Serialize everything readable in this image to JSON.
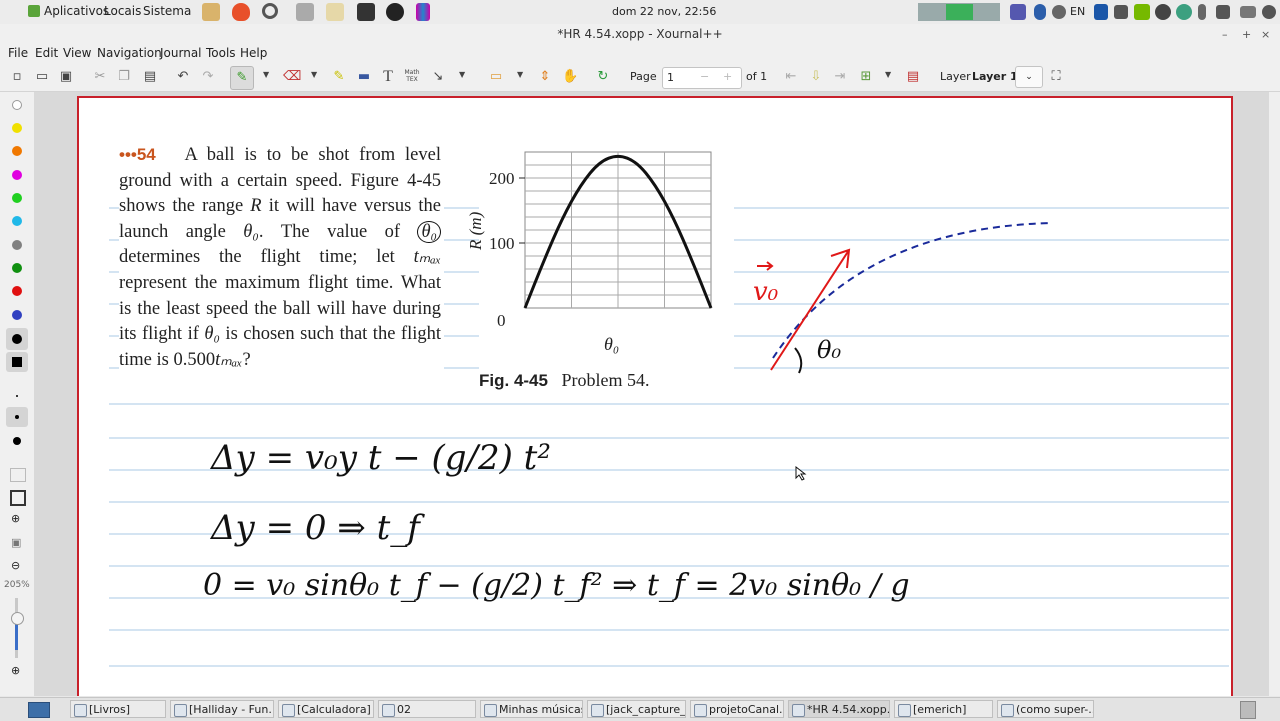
{
  "top_panel": {
    "menus": [
      "Aplicativos",
      "Locais",
      "Sistema"
    ],
    "clock": "dom 22 nov, 22:56",
    "keyboard_layout": "EN"
  },
  "window": {
    "title": "*HR 4.54.xopp - Xournal++",
    "min_glyph": "–",
    "max_glyph": "+",
    "close_glyph": "×"
  },
  "menubar": [
    "File",
    "Edit",
    "View",
    "Navigation",
    "Journal",
    "Tools",
    "Help"
  ],
  "toolbar": {
    "page_label": "Page",
    "page_value": "1",
    "of_label": "of 1",
    "layer_label": "Layer",
    "layer_value": "Layer 1",
    "math_tex_line1": "Math",
    "math_tex_line2": "TEX"
  },
  "palette": {
    "colors": [
      "#ffffff",
      "#f0e000",
      "#f07800",
      "#e000e0",
      "#20d020",
      "#20b8e8",
      "#808080",
      "#109010",
      "#e01010",
      "#3040c0",
      "#000000"
    ],
    "zoom_label": "205%"
  },
  "problem": {
    "number": "•••54",
    "text_1": "A ball is to be shot from level ground with a certain speed. Figure 4-45 shows the range ",
    "R": "R",
    "text_2": " it will have versus the launch angle ",
    "theta0": "θ₀",
    "text_3": ". The value of ",
    "text_4": " determines the flight time; let ",
    "tmax": "tₘₐₓ",
    "text_5": " represent the maximum flight time. What is the least speed the ball will have during its flight if ",
    "text_6": " is chosen such that the flight time is 0.500",
    "text_7": "?"
  },
  "figure": {
    "caption_label": "Fig. 4-45",
    "caption_text": "Problem 54.",
    "xlabel": "θ₀",
    "ylabel": "R (m)"
  },
  "chart_data": {
    "type": "line",
    "title": "",
    "xlabel": "θ₀",
    "ylabel": "R (m)",
    "yticks": [
      0,
      100,
      200
    ],
    "ylim": [
      0,
      240
    ],
    "series": [
      {
        "x": [
          0,
          0.1,
          0.2,
          0.3,
          0.4,
          0.5,
          0.6,
          0.7,
          0.8,
          0.9,
          1.0
        ],
        "values": [
          0,
          72,
          138,
          190,
          225,
          236,
          225,
          190,
          138,
          72,
          0
        ]
      }
    ],
    "grid": true
  },
  "handwriting": {
    "sketch_v0": "v₀",
    "sketch_theta": "θ₀",
    "line1": "Δy = v₀y t − (g/2) t²",
    "line2": "Δy = 0  ⇒  t_f",
    "line3": "0 = v₀ sinθ₀ t_f − (g/2) t_f²  ⇒  t_f = 2v₀ sinθ₀ / g"
  },
  "taskbar": [
    {
      "label": "[Livros]",
      "active": false
    },
    {
      "label": "[Halliday - Fun...",
      "active": false
    },
    {
      "label": "[Calculadora]",
      "active": false
    },
    {
      "label": "02",
      "active": false
    },
    {
      "label": "Minhas músicas",
      "active": false
    },
    {
      "label": "[jack_capture_...",
      "active": false
    },
    {
      "label": "projetoCanal.k...",
      "active": false
    },
    {
      "label": "*HR 4.54.xopp...",
      "active": true
    },
    {
      "label": "[emerich]",
      "active": false
    },
    {
      "label": "(como super-...",
      "active": false
    }
  ]
}
